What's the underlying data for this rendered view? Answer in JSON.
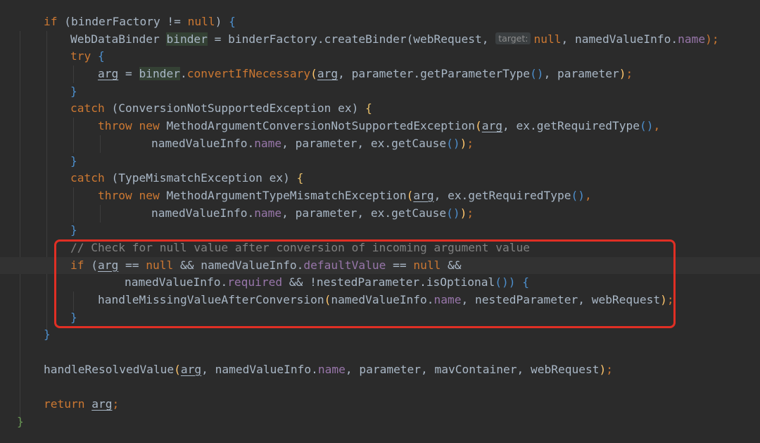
{
  "editor": {
    "lines": [
      {
        "indent": 62,
        "tokens": [
          {
            "t": "if",
            "c": "kw"
          },
          {
            "t": " (binderFactory != ",
            "c": "plain"
          },
          {
            "t": "null",
            "c": "kw"
          },
          {
            "t": ") ",
            "c": "plain"
          },
          {
            "t": "{",
            "c": "brace"
          }
        ]
      },
      {
        "indent": 100,
        "tokens": [
          {
            "t": "WebDataBinder ",
            "c": "plain"
          },
          {
            "t": "binder",
            "c": "plain hl"
          },
          {
            "t": " = binderFactory.createBinder(webRequest, ",
            "c": "plain"
          },
          {
            "t": "target:",
            "c": "hint"
          },
          {
            "t": "null",
            "c": "kw"
          },
          {
            "t": ", namedValueInfo.",
            "c": "plain"
          },
          {
            "t": "name",
            "c": "field"
          },
          {
            "t": ");",
            "c": "kw"
          }
        ]
      },
      {
        "indent": 100,
        "tokens": [
          {
            "t": "try",
            "c": "kw"
          },
          {
            "t": " ",
            "c": "plain"
          },
          {
            "t": "{",
            "c": "brace"
          }
        ]
      },
      {
        "indent": 139,
        "tokens": [
          {
            "t": "arg",
            "c": "plain ul"
          },
          {
            "t": " = ",
            "c": "plain"
          },
          {
            "t": "binder",
            "c": "plain hl"
          },
          {
            "t": ".",
            "c": "plain"
          },
          {
            "t": "convertIfNecessary",
            "c": "kw"
          },
          {
            "t": "(",
            "c": "method"
          },
          {
            "t": "arg",
            "c": "plain ul"
          },
          {
            "t": ", parameter.getParameterType",
            "c": "plain"
          },
          {
            "t": "()",
            "c": "brace"
          },
          {
            "t": ", parameter",
            "c": "plain"
          },
          {
            "t": ")",
            "c": "method"
          },
          {
            "t": ";",
            "c": "kw"
          }
        ]
      },
      {
        "indent": 100,
        "tokens": [
          {
            "t": "}",
            "c": "brace"
          }
        ]
      },
      {
        "indent": 100,
        "tokens": [
          {
            "t": "catch",
            "c": "kw"
          },
          {
            "t": " (ConversionNotSupportedException ex) ",
            "c": "plain"
          },
          {
            "t": "{",
            "c": "brace-y"
          }
        ]
      },
      {
        "indent": 139,
        "tokens": [
          {
            "t": "throw new ",
            "c": "kw"
          },
          {
            "t": "MethodArgumentConversionNotSupportedException",
            "c": "plain"
          },
          {
            "t": "(",
            "c": "method"
          },
          {
            "t": "arg",
            "c": "plain ul"
          },
          {
            "t": ", ex.getRequiredType",
            "c": "plain"
          },
          {
            "t": "()",
            "c": "brace"
          },
          {
            "t": ",",
            "c": "kw"
          }
        ]
      },
      {
        "indent": 215,
        "tokens": [
          {
            "t": "namedValueInfo.",
            "c": "plain"
          },
          {
            "t": "name",
            "c": "field"
          },
          {
            "t": ", parameter, ex.getCause",
            "c": "plain"
          },
          {
            "t": "()",
            "c": "brace"
          },
          {
            "t": ")",
            "c": "method"
          },
          {
            "t": ";",
            "c": "kw"
          }
        ]
      },
      {
        "indent": 100,
        "tokens": [
          {
            "t": "}",
            "c": "brace"
          }
        ]
      },
      {
        "indent": 100,
        "tokens": [
          {
            "t": "catch",
            "c": "kw"
          },
          {
            "t": " (TypeMismatchException ex) ",
            "c": "plain"
          },
          {
            "t": "{",
            "c": "brace-y"
          }
        ]
      },
      {
        "indent": 139,
        "tokens": [
          {
            "t": "throw new ",
            "c": "kw"
          },
          {
            "t": "MethodArgumentTypeMismatchException",
            "c": "plain"
          },
          {
            "t": "(",
            "c": "method"
          },
          {
            "t": "arg",
            "c": "plain ul"
          },
          {
            "t": ", ex.getRequiredType",
            "c": "plain"
          },
          {
            "t": "()",
            "c": "brace"
          },
          {
            "t": ",",
            "c": "kw"
          }
        ]
      },
      {
        "indent": 215,
        "tokens": [
          {
            "t": "namedValueInfo.",
            "c": "plain"
          },
          {
            "t": "name",
            "c": "field"
          },
          {
            "t": ", parameter, ex.getCause",
            "c": "plain"
          },
          {
            "t": "()",
            "c": "brace"
          },
          {
            "t": ")",
            "c": "method"
          },
          {
            "t": ";",
            "c": "kw"
          }
        ]
      },
      {
        "indent": 100,
        "tokens": [
          {
            "t": "}",
            "c": "brace"
          }
        ]
      },
      {
        "indent": 100,
        "tokens": [
          {
            "t": "// Check for null value after conversion of incoming argument value",
            "c": "cmt"
          }
        ]
      },
      {
        "indent": 100,
        "current": true,
        "tokens": [
          {
            "t": "if",
            "c": "kw"
          },
          {
            "t": " (",
            "c": "plain"
          },
          {
            "t": "arg",
            "c": "plain ul"
          },
          {
            "t": " == ",
            "c": "plain"
          },
          {
            "t": "null",
            "c": "kw"
          },
          {
            "t": " && namedValueInfo.",
            "c": "plain"
          },
          {
            "t": "defaultValue",
            "c": "field"
          },
          {
            "t": " == ",
            "c": "plain"
          },
          {
            "t": "null",
            "c": "kw"
          },
          {
            "t": " &&",
            "c": "plain"
          }
        ]
      },
      {
        "indent": 177,
        "tokens": [
          {
            "t": "namedValueInfo.",
            "c": "plain"
          },
          {
            "t": "required",
            "c": "field"
          },
          {
            "t": " && !nestedParameter.isOptional",
            "c": "plain"
          },
          {
            "t": "())",
            "c": "brace"
          },
          {
            "t": " ",
            "c": "plain"
          },
          {
            "t": "{",
            "c": "brace"
          }
        ]
      },
      {
        "indent": 139,
        "tokens": [
          {
            "t": "handleMissingValueAfterConversion",
            "c": "plain"
          },
          {
            "t": "(",
            "c": "method"
          },
          {
            "t": "namedValueInfo.",
            "c": "plain"
          },
          {
            "t": "name",
            "c": "field"
          },
          {
            "t": ", nestedParameter, webRequest",
            "c": "plain"
          },
          {
            "t": ")",
            "c": "method"
          },
          {
            "t": ";",
            "c": "kw"
          }
        ]
      },
      {
        "indent": 100,
        "tokens": [
          {
            "t": "}",
            "c": "brace"
          }
        ]
      },
      {
        "indent": 62,
        "tokens": [
          {
            "t": "}",
            "c": "brace"
          }
        ]
      },
      {
        "indent": 0,
        "tokens": []
      },
      {
        "indent": 62,
        "tokens": [
          {
            "t": "handleResolvedValue",
            "c": "plain"
          },
          {
            "t": "(",
            "c": "method"
          },
          {
            "t": "arg",
            "c": "plain ul"
          },
          {
            "t": ", namedValueInfo.",
            "c": "plain"
          },
          {
            "t": "name",
            "c": "field"
          },
          {
            "t": ", parameter, mavContainer, webRequest",
            "c": "plain"
          },
          {
            "t": ")",
            "c": "method"
          },
          {
            "t": ";",
            "c": "kw"
          }
        ]
      },
      {
        "indent": 0,
        "tokens": []
      },
      {
        "indent": 62,
        "tokens": [
          {
            "t": "return ",
            "c": "kw"
          },
          {
            "t": "arg",
            "c": "plain ul"
          },
          {
            "t": ";",
            "c": "kw"
          }
        ]
      },
      {
        "indent": 24,
        "tokens": [
          {
            "t": "}",
            "c": "brace-g"
          }
        ]
      }
    ]
  },
  "colors": {
    "background": "#2b2b2b",
    "current_line": "#323232",
    "keyword": "#cc7832",
    "identifier": "#a9b7c6",
    "field": "#9876aa",
    "comment": "#808080",
    "highlight_box": "#e02f24"
  }
}
